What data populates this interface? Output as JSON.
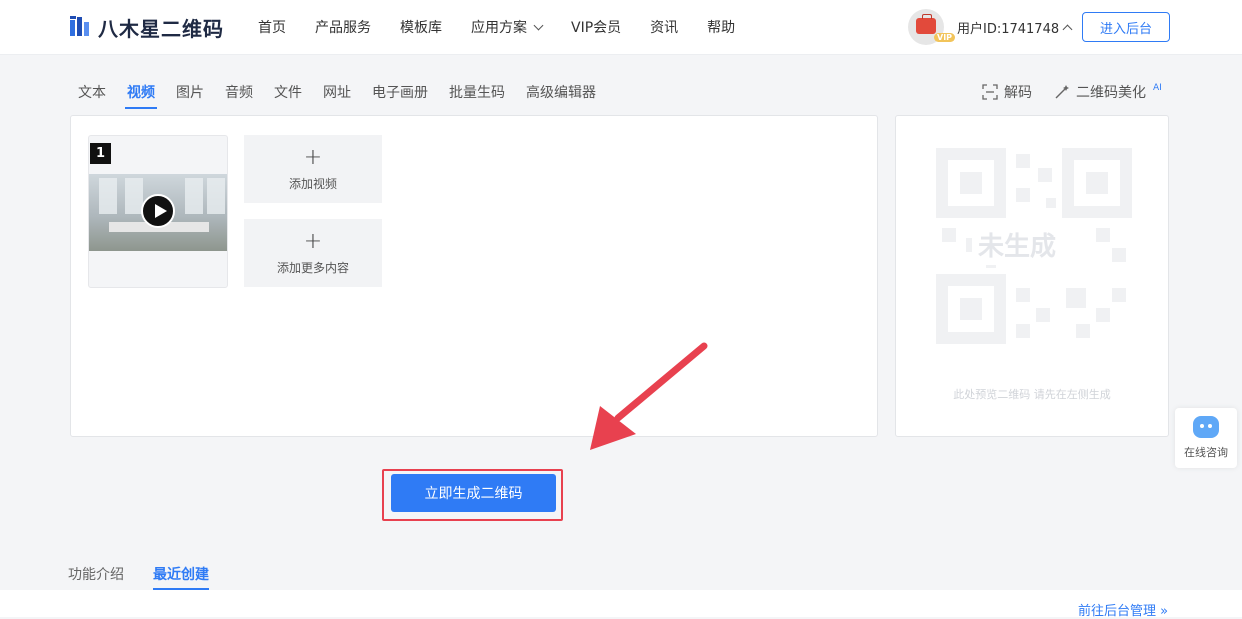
{
  "brand": {
    "name": "八木星二维码"
  },
  "nav": {
    "items": [
      {
        "label": "首页"
      },
      {
        "label": "产品服务"
      },
      {
        "label": "模板库"
      },
      {
        "label": "应用方案",
        "dropdown": true
      },
      {
        "label": "VIP会员"
      },
      {
        "label": "资讯"
      },
      {
        "label": "帮助"
      }
    ]
  },
  "user": {
    "id_label": "用户ID:1741748",
    "vip_badge": "VIP"
  },
  "header": {
    "enter_button": "进入后台"
  },
  "tabs": [
    {
      "label": "文本"
    },
    {
      "label": "视频",
      "active": true
    },
    {
      "label": "图片"
    },
    {
      "label": "音频"
    },
    {
      "label": "文件"
    },
    {
      "label": "网址"
    },
    {
      "label": "电子画册"
    },
    {
      "label": "批量生码"
    },
    {
      "label": "高级编辑器"
    }
  ],
  "tools": {
    "decode": "解码",
    "beautify": "二维码美化",
    "ai_badge": "AI"
  },
  "editor": {
    "video_index": "1",
    "add_video": "添加视频",
    "add_more": "添加更多内容"
  },
  "preview": {
    "status": "未生成",
    "hint": "此处预览二维码 请先在左侧生成"
  },
  "generate_button": "立即生成二维码",
  "consult": {
    "label": "在线咨询"
  },
  "bottom_tabs": [
    {
      "label": "功能介绍"
    },
    {
      "label": "最近创建",
      "active": true
    }
  ],
  "goto_admin": "前往后台管理 »",
  "colors": {
    "accent": "#2f7bf5",
    "highlight_frame": "#e8414f",
    "arrow": "#e8414f"
  }
}
